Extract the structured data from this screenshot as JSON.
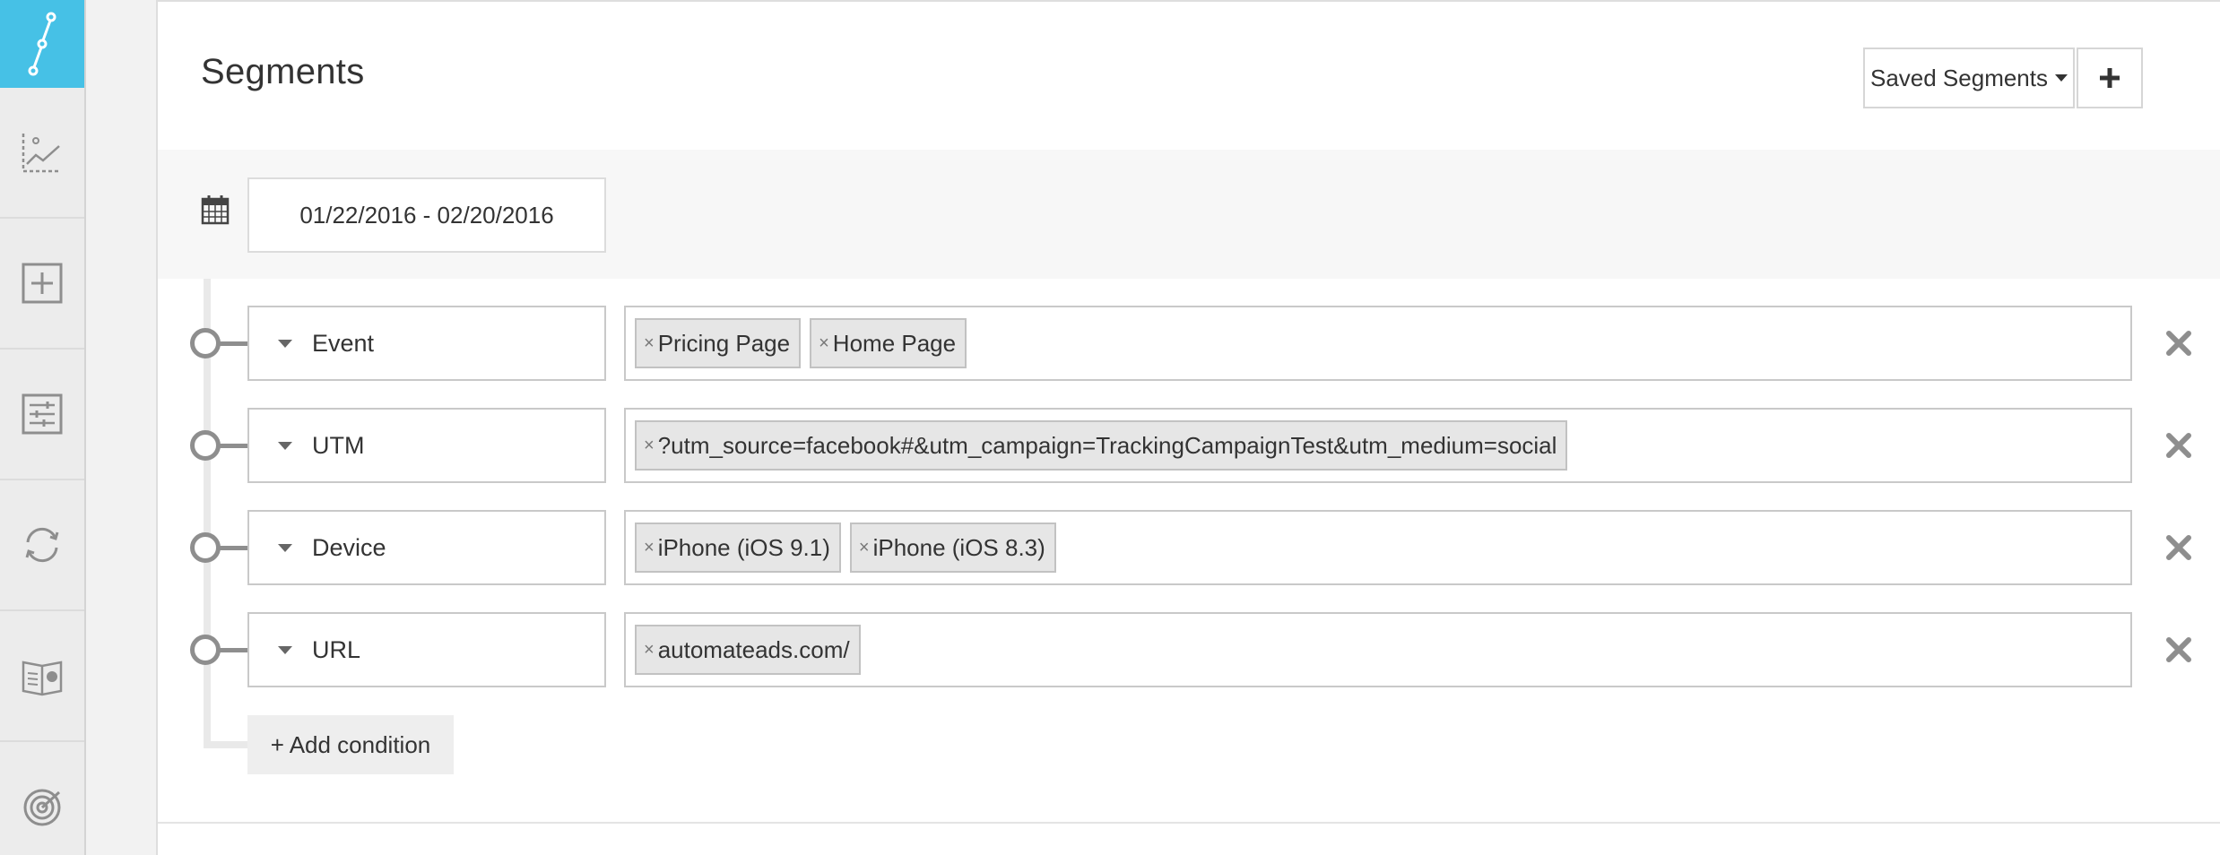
{
  "sidebar": {
    "items": [
      {
        "icon": "funnel-path-icon",
        "active": true
      },
      {
        "icon": "scatter-trend-icon"
      },
      {
        "icon": "add-square-icon"
      },
      {
        "icon": "sliders-icon"
      },
      {
        "icon": "sync-icon"
      },
      {
        "icon": "report-book-icon"
      },
      {
        "icon": "target-icon"
      }
    ]
  },
  "header": {
    "title": "Segments",
    "saved_segments_label": "Saved Segments",
    "add_label": "+"
  },
  "date_range": {
    "icon": "calendar-icon",
    "value": "01/22/2016 - 02/20/2016"
  },
  "conditions": [
    {
      "type": "Event",
      "tags": [
        "Pricing Page",
        "Home Page"
      ]
    },
    {
      "type": "UTM",
      "tags": [
        "?utm_source=facebook#&utm_campaign=TrackingCampaignTest&utm_medium=social"
      ]
    },
    {
      "type": "Device",
      "tags": [
        "iPhone (iOS 9.1)",
        "iPhone (iOS 8.3)"
      ]
    },
    {
      "type": "URL",
      "tags": [
        "automateads.com/"
      ]
    }
  ],
  "tag_remove_glyph": "×",
  "add_condition_label": "+ Add condition",
  "colors": {
    "accent": "#46c1e6",
    "sidebar_bg": "#ececec",
    "tag_bg": "#e6e6e6",
    "icon_gray": "#8e8e8e"
  }
}
